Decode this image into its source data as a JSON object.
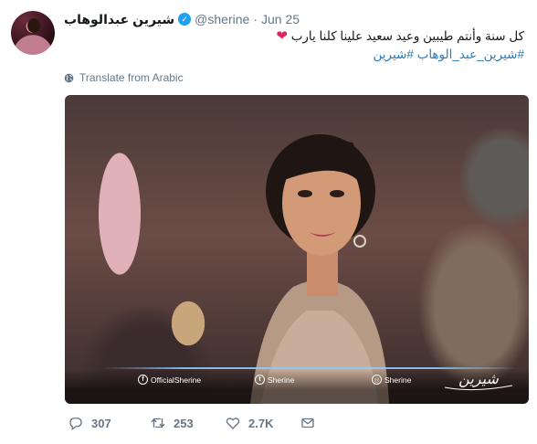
{
  "tweet": {
    "display_name": "شيرين عبدالوهاب",
    "verified_mark": "✓",
    "handle": "@sherine",
    "separator": "·",
    "date": "Jun 25",
    "text": "كل سنة وأنتم طيبين وعيد سعيد علينا كلنا يارب",
    "heart_emoji": "❤",
    "hashtags": "#شيرين_عبد_الوهاب #شيرين",
    "translate_label": "Translate from Arabic"
  },
  "media": {
    "facebook_label": "OfficialSherine",
    "twitter_label": "Sherine",
    "instagram_label": "Sherine",
    "signature_text": "شيرين"
  },
  "actions": {
    "reply_count": "307",
    "retweet_count": "253",
    "like_count": "2.7K"
  },
  "colors": {
    "link": "#2b7bb9",
    "verified": "#1da1f2",
    "muted": "#657786",
    "heart": "#e0245e"
  },
  "icons": [
    "verified-badge-icon",
    "globe-icon",
    "facebook-icon",
    "twitter-bird-icon",
    "instagram-icon",
    "reply-icon",
    "retweet-icon",
    "like-icon",
    "direct-message-icon"
  ]
}
